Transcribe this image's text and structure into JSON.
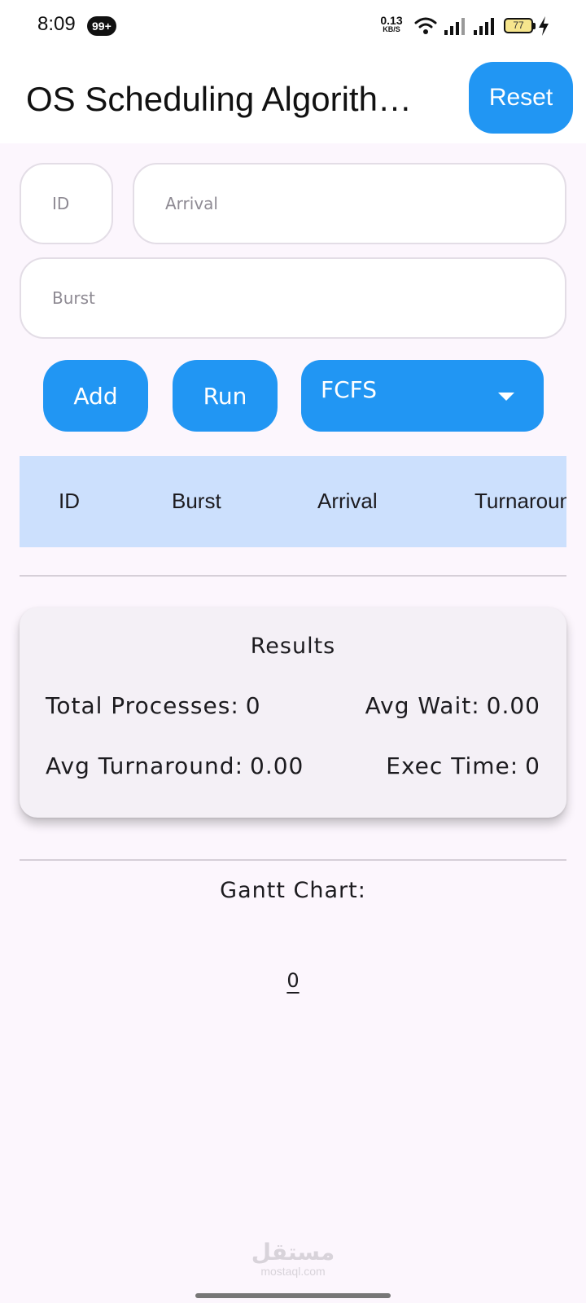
{
  "status_bar": {
    "time": "8:09",
    "badge": "99+",
    "speed_value": "0.13",
    "speed_unit": "KB/S",
    "battery": "77",
    "icons": [
      "wifi-icon",
      "signal-icon",
      "signal-icon",
      "battery-icon",
      "charging-bolt-icon"
    ]
  },
  "app_bar": {
    "title": "OS Scheduling Algorithm Simulator",
    "reset_label": "Reset"
  },
  "form": {
    "id_placeholder": "ID",
    "arrival_placeholder": "Arrival",
    "burst_placeholder": "Burst",
    "add_label": "Add",
    "run_label": "Run",
    "algorithm_selected": "FCFS"
  },
  "table": {
    "columns": [
      "ID",
      "Burst",
      "Arrival",
      "Turnaround"
    ],
    "rows": []
  },
  "results": {
    "title": "Results",
    "total_processes_label": "Total Processes:",
    "total_processes_value": "0",
    "avg_wait_label": "Avg Wait:",
    "avg_wait_value": "0.00",
    "avg_turnaround_label": "Avg Turnaround:",
    "avg_turnaround_value": "0.00",
    "exec_time_label": "Exec Time:",
    "exec_time_value": "0"
  },
  "gantt": {
    "title": "Gantt Chart:",
    "ticks": [
      "0"
    ]
  },
  "watermark": {
    "arabic": "مستقل",
    "latin": "mostaql.com"
  },
  "colors": {
    "primary": "#2196f3",
    "background": "#fcf6fd",
    "table_header": "#cce0fd",
    "card": "#f4f0f6"
  }
}
